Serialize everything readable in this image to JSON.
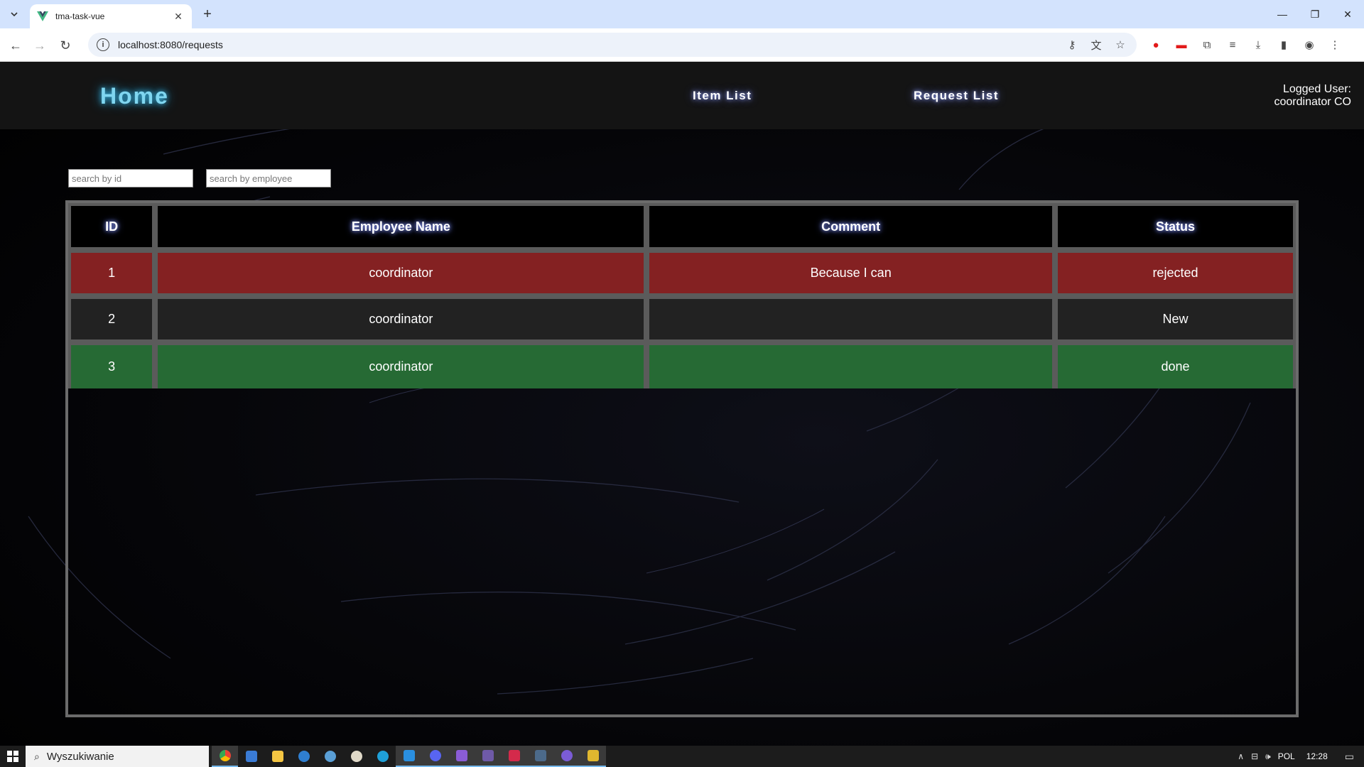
{
  "browser": {
    "tab_title": "tma-task-vue",
    "url": "localhost:8080/requests"
  },
  "app": {
    "brand": "Home",
    "nav": [
      {
        "label": "Item List"
      },
      {
        "label": "Request List"
      }
    ],
    "logged_user_label": "Logged User:",
    "logged_user_name": "coordinator CO"
  },
  "filters": {
    "id_placeholder": "search by id",
    "employee_placeholder": "search by employee"
  },
  "table": {
    "headers": [
      "ID",
      "Employee Name",
      "Comment",
      "Status"
    ],
    "rows": [
      {
        "id": "1",
        "employee": "coordinator",
        "comment": "Because I can",
        "status": "rejected"
      },
      {
        "id": "2",
        "employee": "coordinator",
        "comment": "",
        "status": "New"
      },
      {
        "id": "3",
        "employee": "coordinator",
        "comment": "",
        "status": "done"
      }
    ]
  },
  "colors": {
    "rejected": "#842122",
    "new": "#222222",
    "done": "#266a34",
    "brand": "#7fd6f0"
  },
  "taskbar": {
    "search_label": "Wyszukiwanie",
    "language": "POL",
    "time": "12:28"
  }
}
